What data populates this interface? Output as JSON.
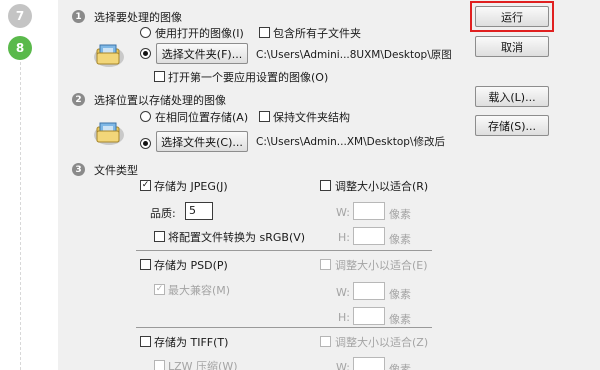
{
  "steps": {
    "prev": "7",
    "current": "8"
  },
  "section1": {
    "num": "1",
    "title": "选择要处理的图像",
    "use_open_label": "使用打开的图像(I)",
    "include_sub_label": "包含所有子文件夹",
    "select_folder_btn": "选择文件夹(F)...",
    "path": "C:\\Users\\Admini...8UXM\\Desktop\\原图",
    "open_first_label": "打开第一个要应用设置的图像(O)"
  },
  "section2": {
    "num": "2",
    "title": "选择位置以存储处理的图像",
    "same_location_label": "在相同位置存储(A)",
    "keep_structure_label": "保持文件夹结构",
    "select_folder_btn": "选择文件夹(C)...",
    "path": "C:\\Users\\Admin...XM\\Desktop\\修改后"
  },
  "section3": {
    "num": "3",
    "title": "文件类型",
    "jpeg": {
      "save_label": "存储为 JPEG(J)",
      "resize_label": "调整大小以适合(R)",
      "quality_label": "品质:",
      "quality_value": "5",
      "convert_label": "将配置文件转换为 sRGB(V)",
      "w_label": "W:",
      "h_label": "H:",
      "unit": "像素"
    },
    "psd": {
      "save_label": "存储为 PSD(P)",
      "resize_label": "调整大小以适合(E)",
      "max_compat_label": "最大兼容(M)",
      "w_label": "W:",
      "h_label": "H:",
      "unit": "像素"
    },
    "tiff": {
      "save_label": "存储为 TIFF(T)",
      "resize_label": "调整大小以适合(Z)",
      "lzw_label": "LZW 压缩(W)",
      "w_label": "W:",
      "unit": "像素"
    }
  },
  "buttons": {
    "run": "运行",
    "cancel": "取消",
    "load": "载入(L)...",
    "save": "存储(S)..."
  }
}
